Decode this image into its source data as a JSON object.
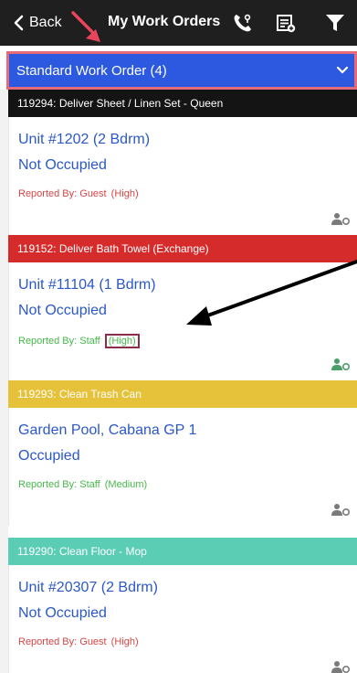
{
  "nav": {
    "back_label": "Back",
    "title": "My Work Orders",
    "icons": [
      "phone-icon",
      "calendar-icon",
      "filter-icon"
    ]
  },
  "category": {
    "label": "Standard Work Order (4)",
    "color": "#2c59e0"
  },
  "work_orders": [
    {
      "header": "119294: Deliver Sheet / Linen Set - Queen",
      "header_color": "#141414",
      "location": "Unit #1202 (2 Bdrm)",
      "occupancy": "Not Occupied",
      "reported_by": "Reported By: Guest",
      "priority": "(High)",
      "text_color": "#d64545"
    },
    {
      "header": "119152: Deliver Bath Towel (Exchange)",
      "header_color": "#d62b2b",
      "location": "Unit #11104 (1 Bdrm)",
      "occupancy": "Not Occupied",
      "reported_by": "Reported By: Staff",
      "priority": "(High)",
      "text_color": "#46b84a"
    },
    {
      "header": "119293: Clean Trash Can",
      "header_color": "#e6c13a",
      "location": "Garden Pool, Cabana GP 1",
      "occupancy": "Occupied",
      "reported_by": "Reported By: Staff",
      "priority": "(Medium)",
      "text_color": "#46b84a"
    },
    {
      "header": "119290: Clean Floor - Mop",
      "header_color": "#5ccdb5",
      "location": "Unit #20307 (2 Bdrm)",
      "occupancy": "Not Occupied",
      "reported_by": "Reported By: Guest",
      "priority": "(High)",
      "text_color": "#d64545"
    }
  ]
}
